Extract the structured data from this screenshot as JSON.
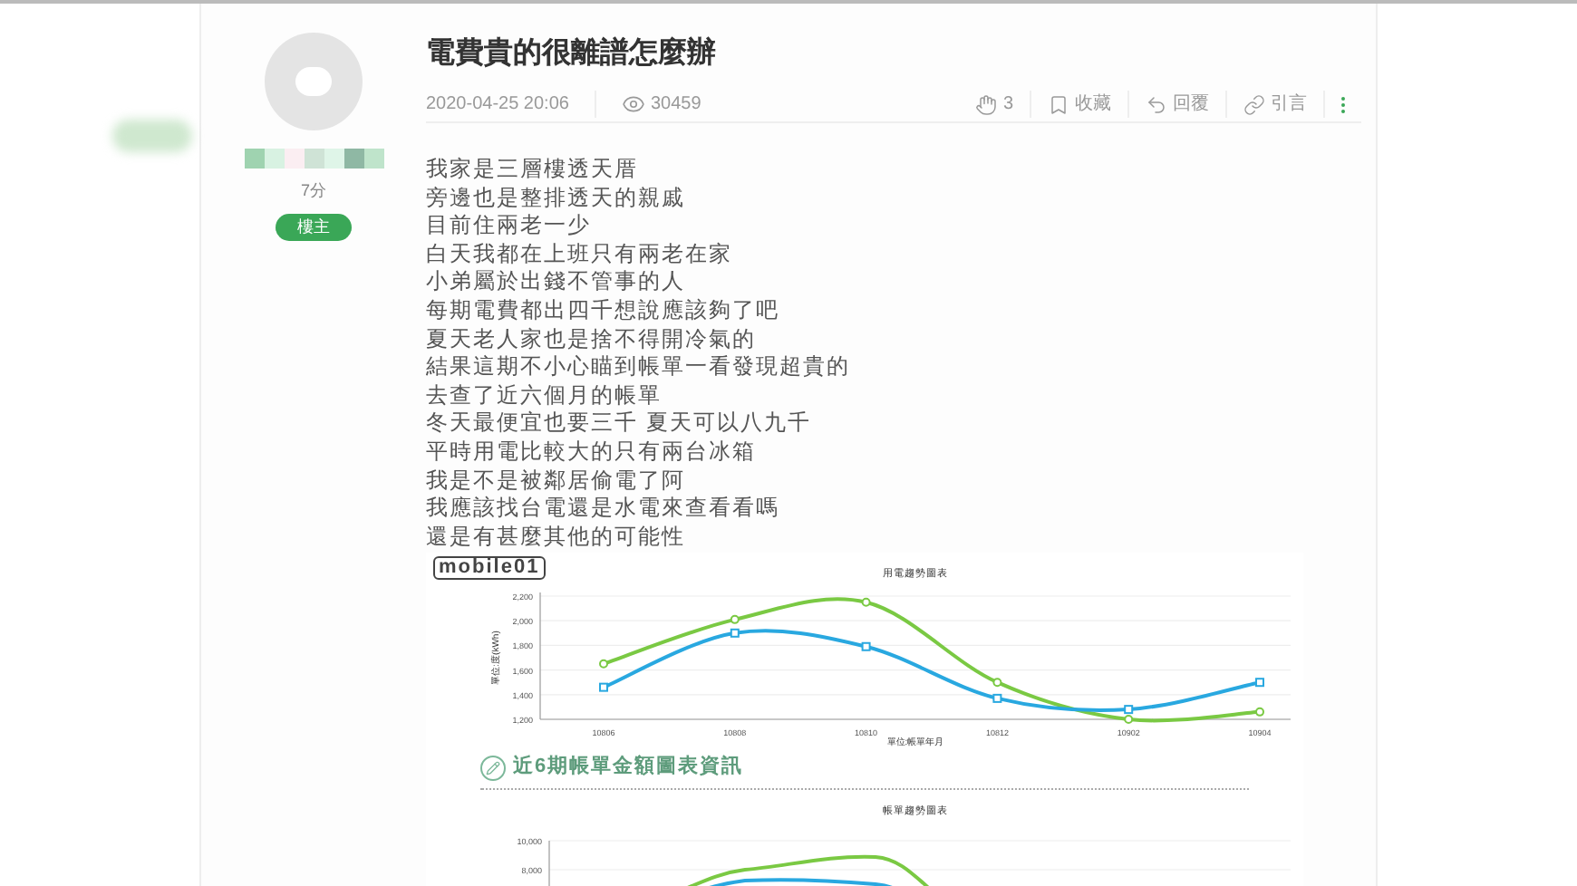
{
  "author": {
    "score": "7分",
    "badge": "樓主"
  },
  "post": {
    "title": "電費貴的很離譜怎麼辦",
    "date": "2020-04-25 20:06",
    "views": "30459"
  },
  "actions": [
    {
      "kind": "clap",
      "label": "3"
    },
    {
      "kind": "bookmark",
      "label": "收藏"
    },
    {
      "kind": "reply",
      "label": "回覆"
    },
    {
      "kind": "quote",
      "label": "引言"
    }
  ],
  "body": [
    "我家是三層樓透天厝",
    "旁邊也是整排透天的親戚",
    "目前住兩老一少",
    "白天我都在上班只有兩老在家",
    "小弟屬於出錢不管事的人",
    "每期電費都出四千想說應該夠了吧",
    "夏天老人家也是捨不得開冷氣的",
    "結果這期不小心瞄到帳單一看發現超貴的",
    "去查了近六個月的帳單",
    "冬天最便宜也要三千 夏天可以八九千",
    "平時用電比較大的只有兩台冰箱",
    "我是不是被鄰居偷電了阿",
    "我應該找台電還是水電來查看看嗎",
    "還是有甚麼其他的可能性"
  ],
  "image": {
    "logo": "mobile01",
    "chart_data": {
      "type": "line",
      "grid": true,
      "title": "用電趨勢圖表",
      "xlabel": "單位:帳單年月",
      "ylabel": "單位:度(kWh)",
      "categories": [
        "10806",
        "10808",
        "10810",
        "10812",
        "10902",
        "10904"
      ],
      "ylim": [
        1200,
        2200
      ],
      "yticks": [
        {
          "value": 1200,
          "label": "1,200"
        },
        {
          "value": 1400,
          "label": "1,400"
        },
        {
          "value": 1600,
          "label": "1,600"
        },
        {
          "value": 1800,
          "label": "1,800"
        },
        {
          "value": 2000,
          "label": "2,000"
        },
        {
          "value": 2200,
          "label": "2,200"
        }
      ],
      "series": [
        {
          "color": "#7ac943",
          "marker": "circle",
          "values": [
            1650,
            2010,
            2150,
            1500,
            1200,
            1260
          ]
        },
        {
          "color": "#29a8e0",
          "marker": "square",
          "values": [
            1460,
            1900,
            1790,
            1370,
            1280,
            1500
          ]
        }
      ]
    },
    "section_heading": "近6期帳單金額圖表資訊",
    "chart2": {
      "title": "帳單趨勢圖表",
      "yticks": [
        "10,000",
        "8,000"
      ]
    }
  }
}
